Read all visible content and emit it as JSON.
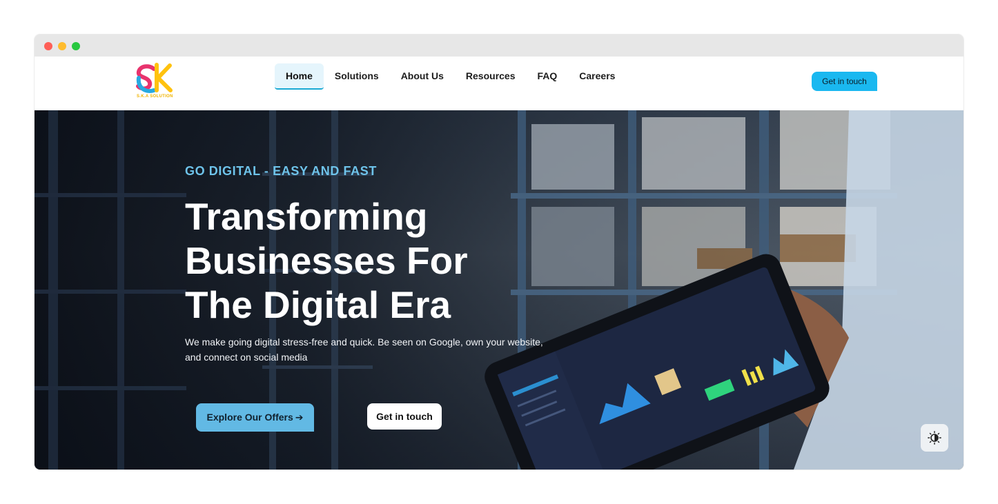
{
  "logo": {
    "text": "S.K.A SOLUTION"
  },
  "nav": {
    "items": [
      {
        "label": "Home",
        "active": true
      },
      {
        "label": "Solutions",
        "active": false
      },
      {
        "label": "About Us",
        "active": false
      },
      {
        "label": "Resources",
        "active": false
      },
      {
        "label": "FAQ",
        "active": false
      },
      {
        "label": "Careers",
        "active": false
      }
    ],
    "cta_label": "Get in touch"
  },
  "hero": {
    "eyebrow": "GO DIGITAL - EASY AND FAST",
    "headline_lines": [
      "Transforming",
      "Businesses For",
      "The Digital Era"
    ],
    "subtext": "We make going digital stress-free and quick. Be seen on Google, own your website, and connect on social media",
    "primary_button": {
      "label": "Explore Our Offers",
      "icon": "arrow-right-icon"
    },
    "secondary_button": {
      "label": "Get in touch"
    }
  },
  "theme_toggle": {
    "icon": "contrast-icon"
  },
  "colors": {
    "accent": "#1ab8f0",
    "eyebrow": "#6ec3ea",
    "primary_button": "#62b9e4",
    "nav_active_bg": "#e5f5fc",
    "nav_active_border": "#1aa9d4"
  }
}
